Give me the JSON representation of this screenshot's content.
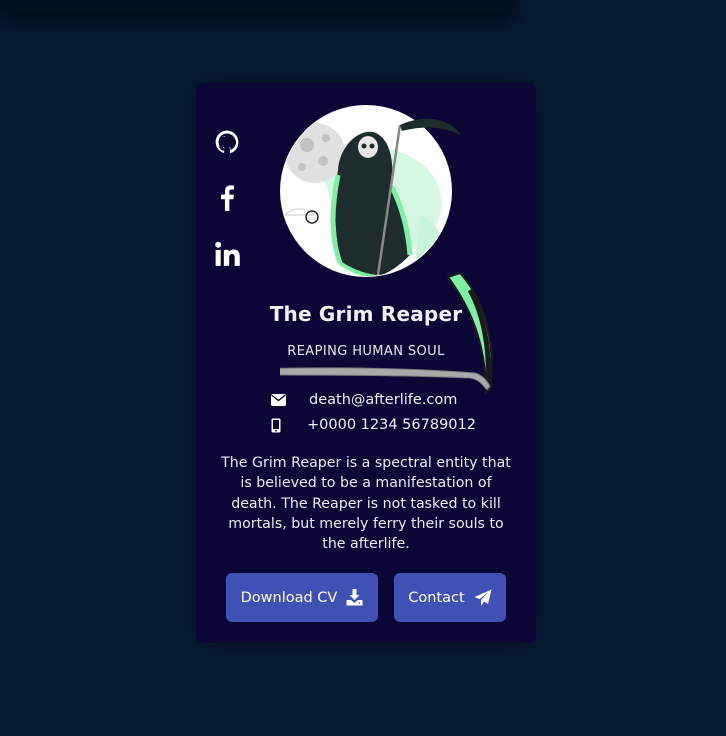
{
  "profile": {
    "name": "The Grim Reaper",
    "title": "REAPING HUMAN SOUL",
    "email": "death@afterlife.com",
    "phone": "+0000 1234 56789012",
    "bio": "The Grim Reaper is a spectral entity that is believed to be a manifestation of death. The Reaper is not tasked to kill mortals, but merely ferry their souls to the afterlife."
  },
  "social": {
    "items": [
      {
        "name": "github",
        "icon": "github-icon"
      },
      {
        "name": "facebook",
        "icon": "facebook-icon"
      },
      {
        "name": "linkedin",
        "icon": "linkedin-icon"
      }
    ]
  },
  "buttons": {
    "download_cv": "Download CV",
    "contact": "Contact"
  },
  "icons": {
    "email": "envelope-icon",
    "phone": "mobile-phone-icon",
    "download": "download-icon",
    "send": "paper-plane-icon"
  },
  "colors": {
    "page_background": "#061a33",
    "card_background": "#0c0636",
    "button": "#3f51b5",
    "accent_green": "#7df0a4"
  }
}
